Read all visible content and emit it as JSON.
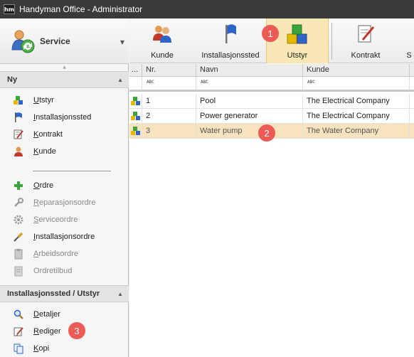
{
  "window": {
    "logo": "hm",
    "title": "Handyman Office - Administrator"
  },
  "module": {
    "label": "Service"
  },
  "ribbon": {
    "items": [
      {
        "label": "Kunde",
        "icon": "customer-icon"
      },
      {
        "label": "Installasjonssted",
        "icon": "flag-icon"
      },
      {
        "label": "Utstyr",
        "icon": "equipment-cubes-icon",
        "active": true
      },
      {
        "label": "Kontrakt",
        "icon": "contract-icon"
      },
      {
        "label": "S",
        "icon": "service-icon"
      }
    ]
  },
  "sections": {
    "ny": {
      "title": "Ny"
    },
    "inst": {
      "title": "Installasjonssted / Utstyr"
    }
  },
  "nav_new": [
    {
      "label": "Utstyr",
      "accel": "U",
      "rest": "tstyr",
      "disabled": false
    },
    {
      "label": "Installasjonssted",
      "accel": "I",
      "rest": "nstallasjonssted",
      "disabled": false
    },
    {
      "label": "Kontrakt",
      "accel": "K",
      "rest": "ontrakt",
      "disabled": false
    },
    {
      "label": "Kunde",
      "accel": "K",
      "rest": "unde",
      "disabled": false
    }
  ],
  "nav_orders": [
    {
      "label": "Ordre",
      "accel": "O",
      "rest": "rdre",
      "disabled": false
    },
    {
      "label": "Reparasjonsordre",
      "accel": "R",
      "rest": "eparasjonsordre",
      "disabled": true
    },
    {
      "label": "Serviceordre",
      "accel": "S",
      "rest": "erviceordre",
      "disabled": true
    },
    {
      "label": "Installasjonsordre",
      "accel": "I",
      "rest": "nstallasjonsordre",
      "disabled": false
    },
    {
      "label": "Arbeidsordre",
      "accel": "A",
      "rest": "rbeidsordre",
      "disabled": true
    },
    {
      "label": "Ordretilbud",
      "accel": "",
      "rest": "Ordretilbud",
      "disabled": true
    }
  ],
  "nav_inst": [
    {
      "label": "Detaljer",
      "accel": "D",
      "rest": "etaljer"
    },
    {
      "label": "Rediger",
      "accel": "R",
      "rest": "ediger"
    },
    {
      "label": "Kopi",
      "accel": "K",
      "rest": "opi"
    }
  ],
  "grid": {
    "columns": [
      "...",
      "Nr.",
      "Navn",
      "Kunde"
    ],
    "filter_glyph": "ABC",
    "rows": [
      {
        "nr": "1",
        "navn": "Pool",
        "kunde": "The Electrical Company"
      },
      {
        "nr": "2",
        "navn": "Power generator",
        "kunde": "The Electrical Company"
      },
      {
        "nr": "3",
        "navn": "Water pump",
        "kunde": "The Water Company",
        "selected": true
      }
    ]
  },
  "badges": {
    "one": "1",
    "two": "2",
    "three": "3"
  },
  "colors": {
    "accent_selected": "#f7e3bd",
    "badge": "#ec5a55",
    "titlebar": "#3a3a3a"
  }
}
